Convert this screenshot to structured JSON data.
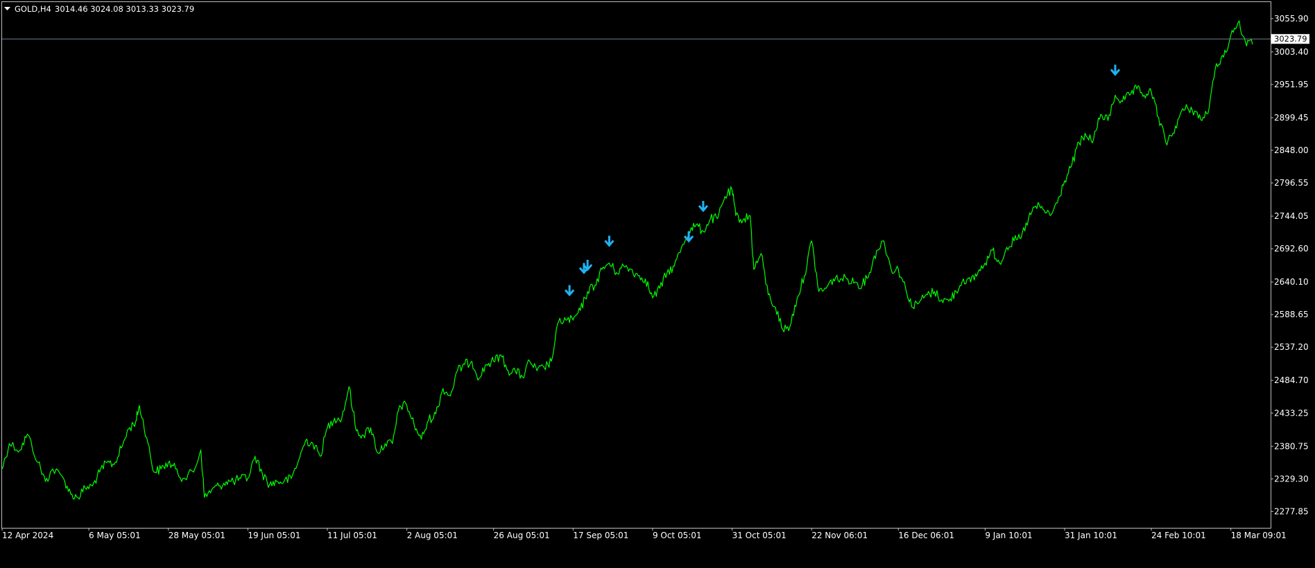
{
  "header": {
    "symbol": "GOLD,H4",
    "ohlc": "3014.46 3024.08 3013.33 3023.79",
    "menu_icon": "triangle-down-icon"
  },
  "colors": {
    "background": "#000000",
    "frame": "#c0c0c0",
    "price_line": "#00ff00",
    "current_price_line": "#6f7f8f",
    "signal_arrow": "#1fb3f2",
    "text": "#ffffff"
  },
  "current_price": {
    "value": 3023.79,
    "label": "3023.79"
  },
  "chart_data": {
    "type": "line",
    "title": "",
    "xlabel": "",
    "ylabel": "",
    "grid": false,
    "ylim": [
      2252,
      3082
    ],
    "x_range": [
      "2024-04-12",
      "2025-03-29"
    ],
    "y_ticks": [
      "3055.90",
      "3003.40",
      "2951.95",
      "2899.45",
      "2848.00",
      "2796.55",
      "2744.05",
      "2692.60",
      "2640.10",
      "2588.65",
      "2537.20",
      "2484.70",
      "2433.25",
      "2380.75",
      "2329.30",
      "2277.85"
    ],
    "x_ticks": [
      {
        "date": "2024-04-12",
        "label": "12 Apr 2024"
      },
      {
        "date": "2024-05-06",
        "label": "6 May 05:01"
      },
      {
        "date": "2024-05-28",
        "label": "28 May 05:01"
      },
      {
        "date": "2024-06-19",
        "label": "19 Jun 05:01"
      },
      {
        "date": "2024-07-11",
        "label": "11 Jul 05:01"
      },
      {
        "date": "2024-08-02",
        "label": "2 Aug 05:01"
      },
      {
        "date": "2024-08-26",
        "label": "26 Aug 05:01"
      },
      {
        "date": "2024-09-17",
        "label": "17 Sep 05:01"
      },
      {
        "date": "2024-10-09",
        "label": "9 Oct 05:01"
      },
      {
        "date": "2024-10-31",
        "label": "31 Oct 05:01"
      },
      {
        "date": "2024-11-22",
        "label": "22 Nov 06:01"
      },
      {
        "date": "2024-12-16",
        "label": "16 Dec 06:01"
      },
      {
        "date": "2025-01-09",
        "label": "9 Jan 10:01"
      },
      {
        "date": "2025-01-31",
        "label": "31 Jan 10:01"
      },
      {
        "date": "2025-02-24",
        "label": "24 Feb 10:01"
      },
      {
        "date": "2025-03-18",
        "label": "18 Mar 09:01"
      }
    ],
    "series": [
      {
        "points": [
          [
            "2024-04-12",
            2345
          ],
          [
            "2024-04-14",
            2385
          ],
          [
            "2024-04-17",
            2375
          ],
          [
            "2024-04-19",
            2400
          ],
          [
            "2024-04-22",
            2355
          ],
          [
            "2024-04-24",
            2325
          ],
          [
            "2024-04-26",
            2345
          ],
          [
            "2024-04-29",
            2330
          ],
          [
            "2024-05-01",
            2305
          ],
          [
            "2024-05-03",
            2300
          ],
          [
            "2024-05-05",
            2315
          ],
          [
            "2024-05-07",
            2318
          ],
          [
            "2024-05-09",
            2340
          ],
          [
            "2024-05-11",
            2355
          ],
          [
            "2024-05-13",
            2352
          ],
          [
            "2024-05-15",
            2378
          ],
          [
            "2024-05-17",
            2408
          ],
          [
            "2024-05-19",
            2420
          ],
          [
            "2024-05-20",
            2445
          ],
          [
            "2024-05-22",
            2395
          ],
          [
            "2024-05-24",
            2340
          ],
          [
            "2024-05-26",
            2345
          ],
          [
            "2024-05-28",
            2355
          ],
          [
            "2024-05-30",
            2345
          ],
          [
            "2024-06-01",
            2330
          ],
          [
            "2024-06-04",
            2340
          ],
          [
            "2024-06-06",
            2375
          ],
          [
            "2024-06-07",
            2300
          ],
          [
            "2024-06-09",
            2312
          ],
          [
            "2024-06-11",
            2318
          ],
          [
            "2024-06-13",
            2325
          ],
          [
            "2024-06-15",
            2325
          ],
          [
            "2024-06-17",
            2330
          ],
          [
            "2024-06-19",
            2330
          ],
          [
            "2024-06-21",
            2365
          ],
          [
            "2024-06-23",
            2338
          ],
          [
            "2024-06-25",
            2320
          ],
          [
            "2024-06-27",
            2325
          ],
          [
            "2024-06-29",
            2325
          ],
          [
            "2024-07-01",
            2330
          ],
          [
            "2024-07-03",
            2358
          ],
          [
            "2024-07-05",
            2390
          ],
          [
            "2024-07-07",
            2385
          ],
          [
            "2024-07-09",
            2365
          ],
          [
            "2024-07-11",
            2410
          ],
          [
            "2024-07-13",
            2425
          ],
          [
            "2024-07-15",
            2425
          ],
          [
            "2024-07-17",
            2475
          ],
          [
            "2024-07-19",
            2405
          ],
          [
            "2024-07-21",
            2398
          ],
          [
            "2024-07-23",
            2410
          ],
          [
            "2024-07-25",
            2370
          ],
          [
            "2024-07-27",
            2385
          ],
          [
            "2024-07-29",
            2385
          ],
          [
            "2024-07-31",
            2445
          ],
          [
            "2024-08-02",
            2445
          ],
          [
            "2024-08-04",
            2415
          ],
          [
            "2024-08-06",
            2392
          ],
          [
            "2024-08-08",
            2422
          ],
          [
            "2024-08-10",
            2432
          ],
          [
            "2024-08-12",
            2472
          ],
          [
            "2024-08-14",
            2460
          ],
          [
            "2024-08-16",
            2500
          ],
          [
            "2024-08-18",
            2510
          ],
          [
            "2024-08-20",
            2515
          ],
          [
            "2024-08-22",
            2488
          ],
          [
            "2024-08-24",
            2510
          ],
          [
            "2024-08-26",
            2515
          ],
          [
            "2024-08-28",
            2525
          ],
          [
            "2024-08-30",
            2500
          ],
          [
            "2024-09-01",
            2500
          ],
          [
            "2024-09-03",
            2490
          ],
          [
            "2024-09-05",
            2515
          ],
          [
            "2024-09-07",
            2500
          ],
          [
            "2024-09-09",
            2505
          ],
          [
            "2024-09-11",
            2515
          ],
          [
            "2024-09-13",
            2578
          ],
          [
            "2024-09-15",
            2580
          ],
          [
            "2024-09-17",
            2580
          ],
          [
            "2024-09-19",
            2595
          ],
          [
            "2024-09-21",
            2625
          ],
          [
            "2024-09-23",
            2635
          ],
          [
            "2024-09-25",
            2660
          ],
          [
            "2024-09-27",
            2670
          ],
          [
            "2024-09-29",
            2655
          ],
          [
            "2024-10-01",
            2665
          ],
          [
            "2024-10-03",
            2660
          ],
          [
            "2024-10-05",
            2650
          ],
          [
            "2024-10-07",
            2645
          ],
          [
            "2024-10-09",
            2615
          ],
          [
            "2024-10-11",
            2630
          ],
          [
            "2024-10-13",
            2655
          ],
          [
            "2024-10-15",
            2665
          ],
          [
            "2024-10-17",
            2695
          ],
          [
            "2024-10-19",
            2720
          ],
          [
            "2024-10-21",
            2730
          ],
          [
            "2024-10-23",
            2720
          ],
          [
            "2024-10-25",
            2740
          ],
          [
            "2024-10-27",
            2740
          ],
          [
            "2024-10-29",
            2775
          ],
          [
            "2024-10-31",
            2785
          ],
          [
            "2024-11-01",
            2745
          ],
          [
            "2024-11-03",
            2738
          ],
          [
            "2024-11-05",
            2745
          ],
          [
            "2024-11-06",
            2660
          ],
          [
            "2024-11-08",
            2685
          ],
          [
            "2024-11-10",
            2620
          ],
          [
            "2024-11-12",
            2600
          ],
          [
            "2024-11-14",
            2565
          ],
          [
            "2024-11-16",
            2570
          ],
          [
            "2024-11-18",
            2615
          ],
          [
            "2024-11-20",
            2650
          ],
          [
            "2024-11-22",
            2705
          ],
          [
            "2024-11-24",
            2625
          ],
          [
            "2024-11-26",
            2630
          ],
          [
            "2024-11-28",
            2645
          ],
          [
            "2024-11-30",
            2645
          ],
          [
            "2024-12-02",
            2645
          ],
          [
            "2024-12-04",
            2640
          ],
          [
            "2024-12-06",
            2635
          ],
          [
            "2024-12-08",
            2655
          ],
          [
            "2024-12-10",
            2690
          ],
          [
            "2024-12-12",
            2705
          ],
          [
            "2024-12-14",
            2660
          ],
          [
            "2024-12-16",
            2660
          ],
          [
            "2024-12-18",
            2630
          ],
          [
            "2024-12-20",
            2600
          ],
          [
            "2024-12-22",
            2610
          ],
          [
            "2024-12-24",
            2620
          ],
          [
            "2024-12-26",
            2625
          ],
          [
            "2024-12-28",
            2612
          ],
          [
            "2024-12-30",
            2610
          ],
          [
            "2025-01-01",
            2625
          ],
          [
            "2025-01-03",
            2645
          ],
          [
            "2025-01-05",
            2640
          ],
          [
            "2025-01-07",
            2655
          ],
          [
            "2025-01-09",
            2670
          ],
          [
            "2025-01-11",
            2690
          ],
          [
            "2025-01-13",
            2670
          ],
          [
            "2025-01-15",
            2695
          ],
          [
            "2025-01-17",
            2705
          ],
          [
            "2025-01-19",
            2710
          ],
          [
            "2025-01-21",
            2740
          ],
          [
            "2025-01-23",
            2760
          ],
          [
            "2025-01-25",
            2755
          ],
          [
            "2025-01-27",
            2745
          ],
          [
            "2025-01-29",
            2765
          ],
          [
            "2025-01-31",
            2800
          ],
          [
            "2025-02-02",
            2825
          ],
          [
            "2025-02-04",
            2860
          ],
          [
            "2025-02-06",
            2870
          ],
          [
            "2025-02-08",
            2865
          ],
          [
            "2025-02-10",
            2905
          ],
          [
            "2025-02-12",
            2895
          ],
          [
            "2025-02-14",
            2935
          ],
          [
            "2025-02-16",
            2925
          ],
          [
            "2025-02-18",
            2935
          ],
          [
            "2025-02-20",
            2945
          ],
          [
            "2025-02-22",
            2935
          ],
          [
            "2025-02-24",
            2940
          ],
          [
            "2025-02-26",
            2900
          ],
          [
            "2025-02-28",
            2860
          ],
          [
            "2025-03-02",
            2875
          ],
          [
            "2025-03-04",
            2905
          ],
          [
            "2025-03-06",
            2915
          ],
          [
            "2025-03-08",
            2910
          ],
          [
            "2025-03-10",
            2895
          ],
          [
            "2025-03-12",
            2915
          ],
          [
            "2025-03-14",
            2985
          ],
          [
            "2025-03-16",
            2995
          ],
          [
            "2025-03-18",
            3030
          ],
          [
            "2025-03-20",
            3050
          ],
          [
            "2025-03-22",
            3020
          ],
          [
            "2025-03-24",
            3015
          ]
        ]
      }
    ],
    "signals": [
      {
        "date": "2024-09-16",
        "price": 2610
      },
      {
        "date": "2024-09-20",
        "price": 2645
      },
      {
        "date": "2024-09-21",
        "price": 2650
      },
      {
        "date": "2024-09-27",
        "price": 2688
      },
      {
        "date": "2024-10-19",
        "price": 2695
      },
      {
        "date": "2024-10-23",
        "price": 2743
      },
      {
        "date": "2025-02-14",
        "price": 2958
      }
    ]
  }
}
